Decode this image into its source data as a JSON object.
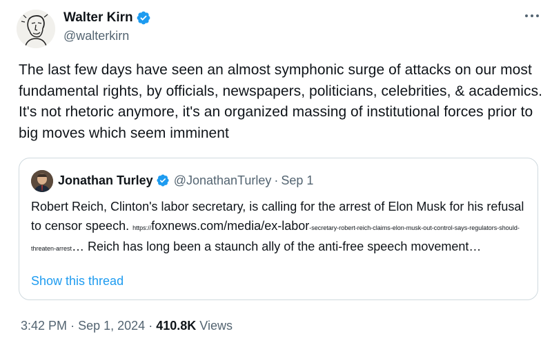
{
  "author": {
    "name": "Walter Kirn",
    "handle": "@walterkirn",
    "verified": true,
    "avatar_icon": "sketch-portrait-avatar"
  },
  "more_icon": "more-horizontal-icon",
  "tweet": {
    "text": "The last few days have seen an almost symphonic surge of attacks on our most fundamental rights, by officials, newspapers, politicians, celebrities, & academics. It's not rhetoric anymore, it's an organized massing of institutional forces prior to big moves which seem imminent"
  },
  "quote": {
    "name": "Jonathan Turley",
    "handle": "@JonathanTurley",
    "separator": "·",
    "date": "Sep 1",
    "verified": true,
    "text_before_link": "Robert Reich, Clinton's labor secretary, is calling for the arrest of Elon Musk for his refusal to censor speech.",
    "link_prefix": "https://",
    "link_domain": "foxnews.com/media/ex-labor",
    "link_tail": "-secretary-robert-reich-claims-elon-musk-out-control-says-regulators-should-threaten-arrest",
    "text_after_link": "… Reich has long been a staunch ally of the anti-free speech movement…",
    "show_thread": "Show this thread"
  },
  "meta": {
    "time": "3:42 PM",
    "sep1": "·",
    "date": "Sep 1, 2024",
    "sep2": "·",
    "views_count": "410.8K",
    "views_label": "Views"
  },
  "colors": {
    "text": "#0f1419",
    "secondary": "#536471",
    "link": "#1d9bf0",
    "verified": "#1d9bf0",
    "border": "#cfd9de"
  }
}
